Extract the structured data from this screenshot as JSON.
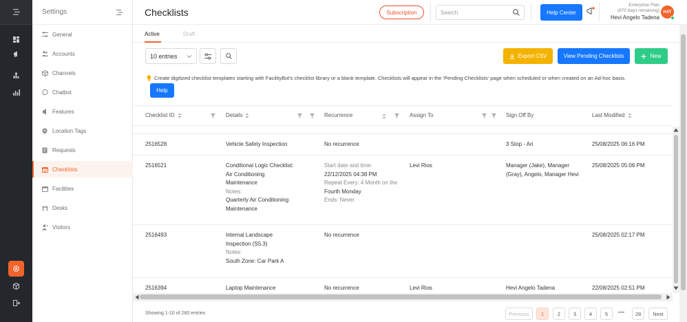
{
  "settings_panel": {
    "title": "Settings",
    "items": [
      {
        "label": "General",
        "icon": "sliders-icon"
      },
      {
        "label": "Accounts",
        "icon": "users-icon"
      },
      {
        "label": "Channels",
        "icon": "cube-icon"
      },
      {
        "label": "Chatbot",
        "icon": "chat-icon"
      },
      {
        "label": "Features",
        "icon": "megaphone-icon"
      },
      {
        "label": "Location Tags",
        "icon": "pin-icon"
      },
      {
        "label": "Requests",
        "icon": "flag-icon"
      },
      {
        "label": "Checklists",
        "icon": "calendar-check-icon",
        "active": true
      },
      {
        "label": "Facilities",
        "icon": "calendar-icon"
      },
      {
        "label": "Desks",
        "icon": "desk-icon"
      },
      {
        "label": "Visitors",
        "icon": "visitor-icon"
      }
    ]
  },
  "header": {
    "title": "Checklists",
    "subscription_label": "Subscription",
    "search_placeholder": "Search",
    "help_center_label": "Help Center",
    "plan_name": "Enterprise Plan",
    "plan_days": "(670 days remaining)",
    "user_name": "Hevi Angelo Tadena",
    "avatar_initials": "HAT"
  },
  "tabs": {
    "active": "Active",
    "draft": "Draft"
  },
  "toolbar": {
    "page_size": "10 entries",
    "export_label": "Export CSV",
    "pending_label": "View Pending Checklists",
    "new_label": "New"
  },
  "info": {
    "text": "Create digitized checklist templates starting with FacilityBot's checklist library or a blank template. Checklists will appear in the 'Pending Checklists' page when scheduled or when created on an Ad-hoc basis.",
    "help_label": "Help"
  },
  "table": {
    "columns": [
      "Checklist ID",
      "Details",
      "Recurrence",
      "Assign To",
      "Sign Off By",
      "Last Modified"
    ],
    "rows": [
      {
        "id": "2516528",
        "details": [
          "Vehicle Safety Inspection"
        ],
        "recurrence": [
          "No recurrence"
        ],
        "assign": "",
        "signoff": "3 Stop - Ari",
        "modified": "25/08/2025 06:16 PM"
      },
      {
        "id": "2516521",
        "details": [
          "Conditional Logic Checklist:",
          "Air Conditioning",
          "Maintenance",
          "Notes:",
          "Quarterly Air Conditioning",
          "Maintenance"
        ],
        "recurrence": [
          "Start date and time:",
          "22/12/2025 04:38 PM",
          "Repeat Every: 4 Month on the",
          "Fourth Monday",
          "Ends: Never"
        ],
        "assign": "Levi Rios",
        "signoff": "Manager (Jake), Manager (Gray), Angelo, Manager Hevi",
        "modified": "25/08/2025 05:06 PM"
      },
      {
        "id": "2516493",
        "details": [
          "Internal Landscape",
          "Inspection (S5.3)",
          "Notes:",
          "South Zone: Car Park A"
        ],
        "recurrence": [
          "No recurrence"
        ],
        "assign": "",
        "signoff": "",
        "modified": "25/08/2025 02:17 PM"
      },
      {
        "id": "2516394",
        "details": [
          "Laptop Maintenance"
        ],
        "recurrence": [
          "No recurrence"
        ],
        "assign": "Levi Rios",
        "signoff": "Hevi Angelo Tadena",
        "modified": "22/08/2025 02:51 PM"
      }
    ]
  },
  "footer": {
    "showing": "Showing 1-10 of 280 entries",
    "previous": "Previous",
    "pages": [
      "1",
      "2",
      "3",
      "4",
      "5"
    ],
    "ellipsis": "•••",
    "last_page": "28",
    "next": "Next",
    "current_page": "1"
  },
  "colors": {
    "accent": "#f0642c",
    "primary": "#1677ff",
    "export": "#f5b301",
    "new": "#2ecc87",
    "rail": "#24272b"
  }
}
